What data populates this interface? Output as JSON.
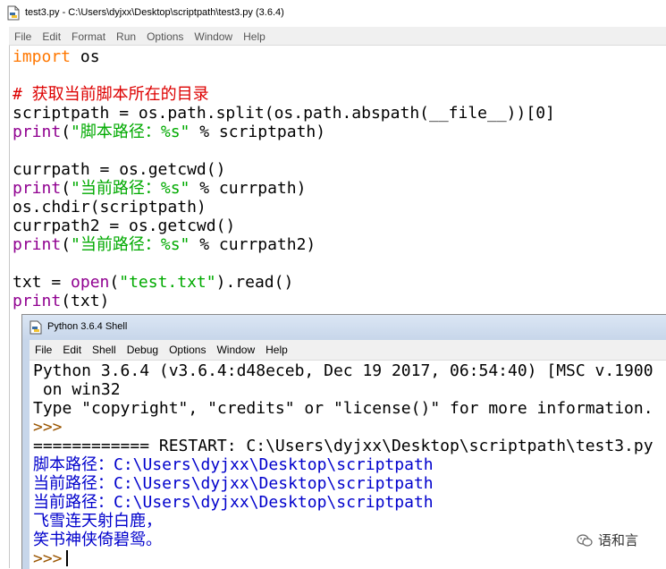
{
  "editor_window": {
    "title": "test3.py - C:\\Users\\dyjxx\\Desktop\\scriptpath\\test3.py (3.6.4)",
    "menu": [
      "File",
      "Edit",
      "Format",
      "Run",
      "Options",
      "Window",
      "Help"
    ],
    "code": {
      "l1_kw": "import",
      "l1_rest": " os",
      "l3_comment": "# 获取当前脚本所在的目录",
      "l4": "scriptpath = os.path.split(os.path.abspath(__file__))[0]",
      "l5_fn": "print",
      "l5_a": "(",
      "l5_str": "\"脚本路径：%s\"",
      "l5_b": " % scriptpath)",
      "l7": "currpath = os.getcwd()",
      "l8_fn": "print",
      "l8_a": "(",
      "l8_str": "\"当前路径：%s\"",
      "l8_b": " % currpath)",
      "l9": "os.chdir(scriptpath)",
      "l10": "currpath2 = os.getcwd()",
      "l11_fn": "print",
      "l11_a": "(",
      "l11_str": "\"当前路径：%s\"",
      "l11_b": " % currpath2)",
      "l13_a": "txt = ",
      "l13_fn": "open",
      "l13_b": "(",
      "l13_str": "\"test.txt\"",
      "l13_c": ").read()",
      "l14_fn": "print",
      "l14_b": "(txt)"
    }
  },
  "shell_window": {
    "title": "Python 3.6.4 Shell",
    "menu": [
      "File",
      "Edit",
      "Shell",
      "Debug",
      "Options",
      "Window",
      "Help"
    ],
    "lines": {
      "banner1": "Python 3.6.4 (v3.6.4:d48eceb, Dec 19 2017, 06:54:40) [MSC v.1900",
      "banner2": " on win32",
      "banner3": "Type \"copyright\", \"credits\" or \"license()\" for more information.",
      "prompt1": ">>>",
      "restart": "============ RESTART: C:\\Users\\dyjxx\\Desktop\\scriptpath\\test3.py",
      "out1": "脚本路径：C:\\Users\\dyjxx\\Desktop\\scriptpath",
      "out2": "当前路径：C:\\Users\\dyjxx\\Desktop\\scriptpath",
      "out3": "当前路径：C:\\Users\\dyjxx\\Desktop\\scriptpath",
      "out4": "飞雪连天射白鹿，",
      "out5": "笑书神侠倚碧鸳。",
      "prompt2": ">>>"
    }
  },
  "watermark": {
    "text": "语和言",
    "icon": "wechat-icon"
  }
}
